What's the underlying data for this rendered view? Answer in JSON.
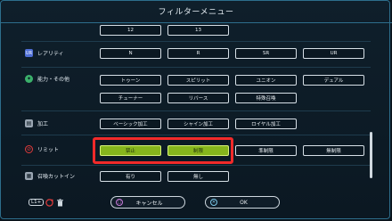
{
  "header": {
    "title": "フィルターメニュー"
  },
  "levels": {
    "buttons": [
      "12",
      "13"
    ]
  },
  "rarity": {
    "label": "レアリティ",
    "buttons": [
      "N",
      "R",
      "SR",
      "UR"
    ]
  },
  "ability": {
    "label": "能力・その他",
    "buttons_row1": [
      "トゥーン",
      "スピリット",
      "ユニオン",
      "デュアル"
    ],
    "buttons_row2": [
      "チューナー",
      "リバース",
      "特殊召喚"
    ]
  },
  "processing": {
    "label": "加工",
    "buttons": [
      "ベーシック加工",
      "シャイン加工",
      "ロイヤル加工"
    ]
  },
  "limit": {
    "label": "リミット",
    "buttons": [
      "禁止",
      "制限",
      "準制限",
      "無制限"
    ],
    "selected": [
      "禁止",
      "制限"
    ]
  },
  "cut_in": {
    "label": "召喚カットイン",
    "buttons": [
      "有り",
      "無し"
    ]
  },
  "footer": {
    "l1_label": "L1+",
    "cancel_label": "キャンセル",
    "ok_label": "OK"
  },
  "colors": {
    "accent_border": "#2d6e8c",
    "selected_fill": "#86b51c",
    "highlight": "#f22a2a",
    "ability_icon": "#3bb06b",
    "limit_icon": "#e23b3b"
  }
}
